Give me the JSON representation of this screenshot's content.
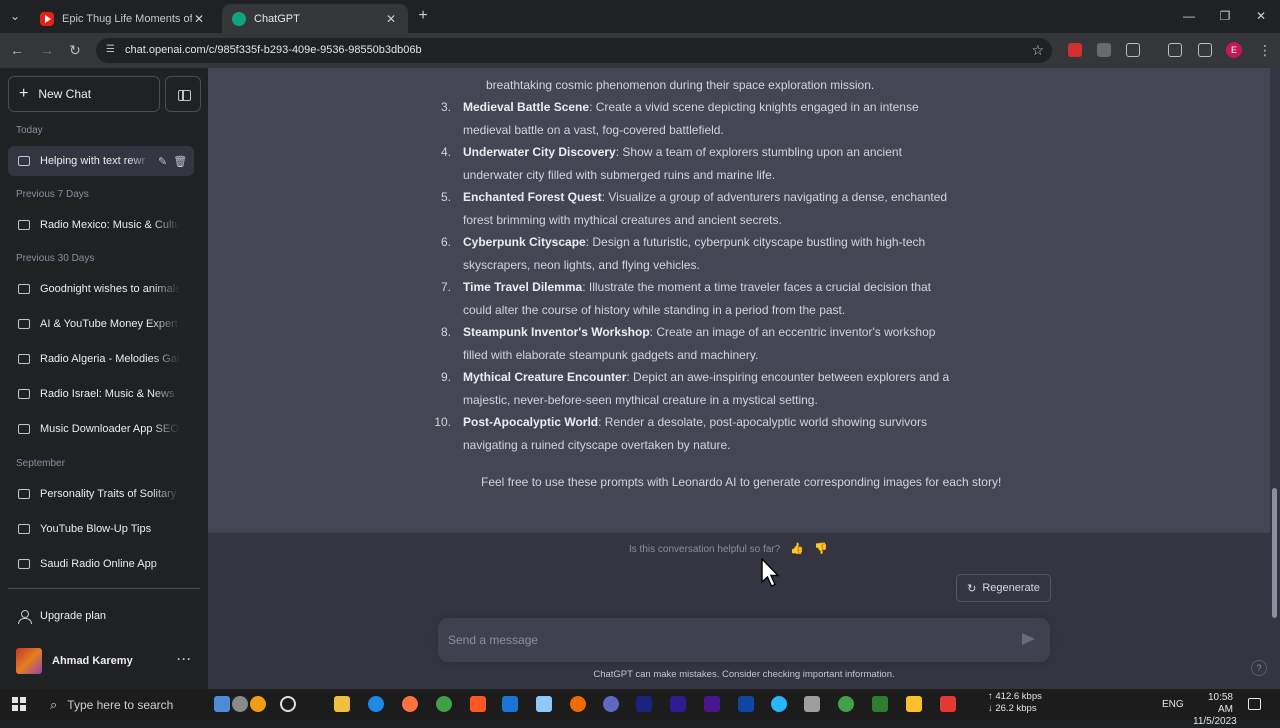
{
  "browser": {
    "tabs": [
      {
        "title": "Epic Thug Life Moments of Na",
        "active": false
      },
      {
        "title": "ChatGPT",
        "active": true
      }
    ],
    "url": "chat.openai.com/c/985f335f-b293-409e-9536-98550b3db06b",
    "profile_initial": "E"
  },
  "sidebar": {
    "new_chat_label": "New Chat",
    "sections": [
      {
        "label": "Today",
        "items": [
          "Helping with text rewr"
        ]
      },
      {
        "label": "Previous 7 Days",
        "items": [
          "Radio Mexico: Music & Cultur"
        ]
      },
      {
        "label": "Previous 30 Days",
        "items": [
          "Goodnight wishes to animals",
          "AI & YouTube Money Expert",
          "Radio Algeria - Melodies Gal",
          "Radio Israel: Music & News",
          "Music Downloader App SEO"
        ]
      },
      {
        "label": "September",
        "items": [
          "Personality Traits of Solitary I",
          "YouTube Blow-Up Tips",
          "Saudi Radio Online App"
        ]
      }
    ],
    "upgrade_label": "Upgrade plan",
    "user_name": "Ahmad Karemy"
  },
  "conversation": {
    "partial_line": "breathtaking cosmic phenomenon during their space exploration mission.",
    "items": [
      {
        "num": "3.",
        "title": "Medieval Battle Scene",
        "text": ": Create a vivid scene depicting knights engaged in an intense",
        "cont": "medieval battle on a vast, fog-covered battlefield."
      },
      {
        "num": "4.",
        "title": "Underwater City Discovery",
        "text": ": Show a team of explorers stumbling upon an ancient",
        "cont": "underwater city filled with submerged ruins and marine life."
      },
      {
        "num": "5.",
        "title": "Enchanted Forest Quest",
        "text": ": Visualize a group of adventurers navigating a dense, enchanted",
        "cont": "forest brimming with mythical creatures and ancient secrets."
      },
      {
        "num": "6.",
        "title": "Cyberpunk Cityscape",
        "text": ": Design a futuristic, cyberpunk cityscape bustling with high-tech",
        "cont": "skyscrapers, neon lights, and flying vehicles."
      },
      {
        "num": "7.",
        "title": "Time Travel Dilemma",
        "text": ": Illustrate the moment a time traveler faces a crucial decision that",
        "cont": "could alter the course of history while standing in a period from the past."
      },
      {
        "num": "8.",
        "title": "Steampunk Inventor's Workshop",
        "text": ": Create an image of an eccentric inventor's workshop",
        "cont": "filled with elaborate steampunk gadgets and machinery."
      },
      {
        "num": "9.",
        "title": "Mythical Creature Encounter",
        "text": ": Depict an awe-inspiring encounter between explorers and a",
        "cont": "majestic, never-before-seen mythical creature in a mystical setting."
      },
      {
        "num": "10.",
        "title": "Post-Apocalyptic World",
        "text": ": Render a desolate, post-apocalyptic world showing survivors",
        "cont": "navigating a ruined cityscape overtaken by nature."
      }
    ],
    "closing": "Feel free to use these prompts with Leonardo AI to generate corresponding images for each story!"
  },
  "feedback": {
    "question": "Is this conversation helpful so far?"
  },
  "regenerate_label": "Regenerate",
  "composer": {
    "placeholder": "Send a message"
  },
  "disclaimer": "ChatGPT can make mistakes. Consider checking important information.",
  "taskbar": {
    "search_placeholder": "Type here to search",
    "net_up": "412.6 kbps",
    "net_down": "26.2 kbps",
    "language": "ENG",
    "time": "10:58 AM",
    "date": "11/5/2023"
  },
  "colors": {
    "sidebar": "#202123",
    "main": "#343541",
    "assistant": "#444654",
    "composer": "#40414f"
  }
}
